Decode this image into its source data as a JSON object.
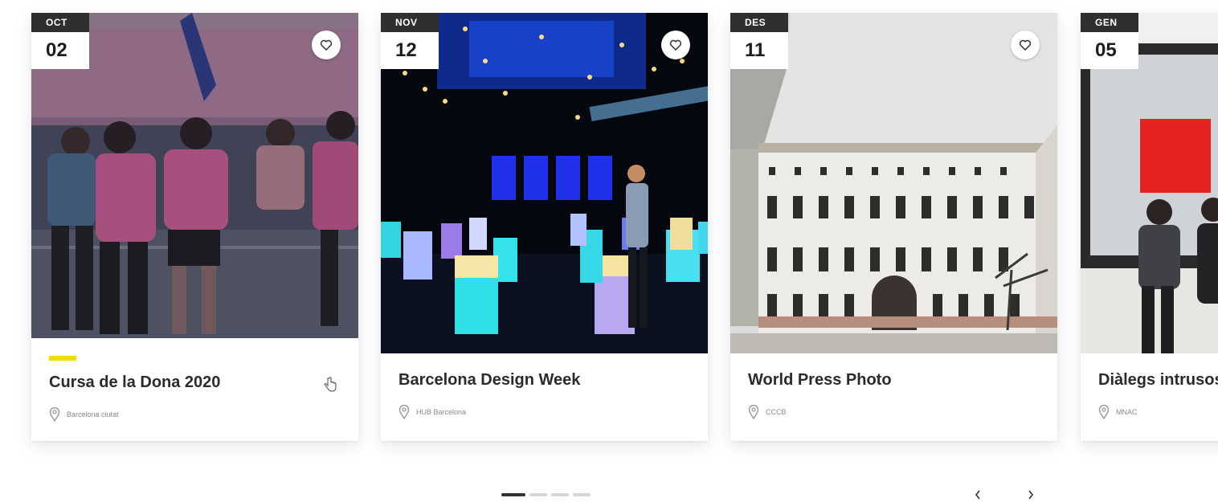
{
  "events": [
    {
      "month": "OCT",
      "day": "02",
      "title": "Cursa de la Dona 2020",
      "location": "Barcelona ciutat",
      "image": "runners-race-photo",
      "highlighted": true
    },
    {
      "month": "NOV",
      "day": "12",
      "title": "Barcelona Design Week",
      "location": "HUB Barcelona",
      "image": "light-installation-photo",
      "highlighted": false
    },
    {
      "month": "DES",
      "day": "11",
      "title": "World Press Photo",
      "location": "CCCB",
      "image": "building-courtyard-photo",
      "highlighted": false
    },
    {
      "month": "GEN",
      "day": "05",
      "title": "Diàlegs intrusos",
      "location": "MNAC",
      "image": "museum-gallery-photo",
      "highlighted": false
    }
  ],
  "icons": {
    "favorite": "heart-outline-icon",
    "location": "map-pin-icon",
    "prev": "chevron-left-icon",
    "next": "chevron-right-icon"
  },
  "pagination": {
    "pages": 4,
    "active_index": 0
  },
  "colors": {
    "accent": "#f3dd00",
    "badge_dark": "#2f2f2f",
    "text": "#2b2b2b"
  }
}
